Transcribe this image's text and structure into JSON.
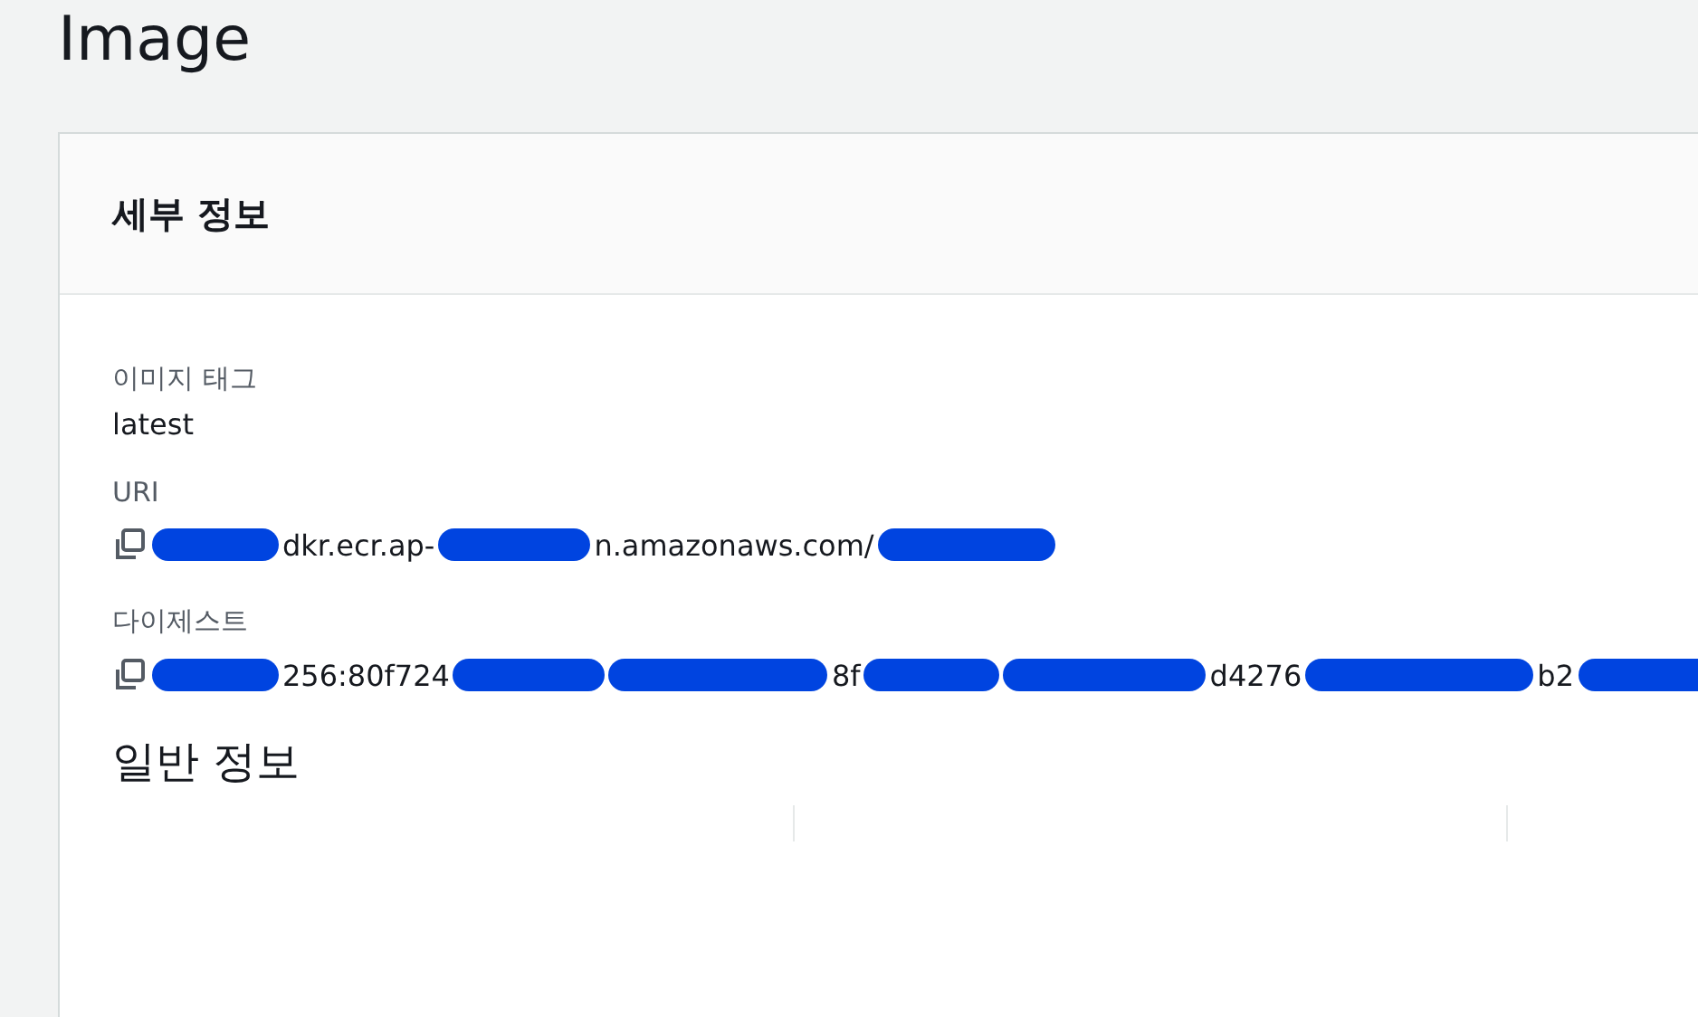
{
  "page_title": "Image",
  "details": {
    "title": "세부 정보",
    "fields": [
      {
        "label": "이미지 태그",
        "kind": "text",
        "value": "latest"
      },
      {
        "label": "URI",
        "kind": "copy",
        "segments": [
          {
            "kind": "redacted"
          },
          {
            "kind": "text",
            "text": "dkr.ecr.ap-"
          },
          {
            "kind": "redacted"
          },
          {
            "kind": "text",
            "text": "n.amazonaws.com/"
          },
          {
            "kind": "redacted"
          }
        ]
      },
      {
        "label": "다이제스트",
        "kind": "copy",
        "segments": [
          {
            "kind": "redacted"
          },
          {
            "kind": "text",
            "text": "256:80f724"
          },
          {
            "kind": "redacted"
          },
          {
            "kind": "redacted"
          },
          {
            "kind": "text",
            "text": "8f"
          },
          {
            "kind": "redacted"
          },
          {
            "kind": "redacted"
          },
          {
            "kind": "text",
            "text": "d4276"
          },
          {
            "kind": "redacted"
          },
          {
            "kind": "text",
            "text": "b2"
          },
          {
            "kind": "redacted"
          }
        ]
      }
    ]
  },
  "general": {
    "title": "일반 정보"
  }
}
